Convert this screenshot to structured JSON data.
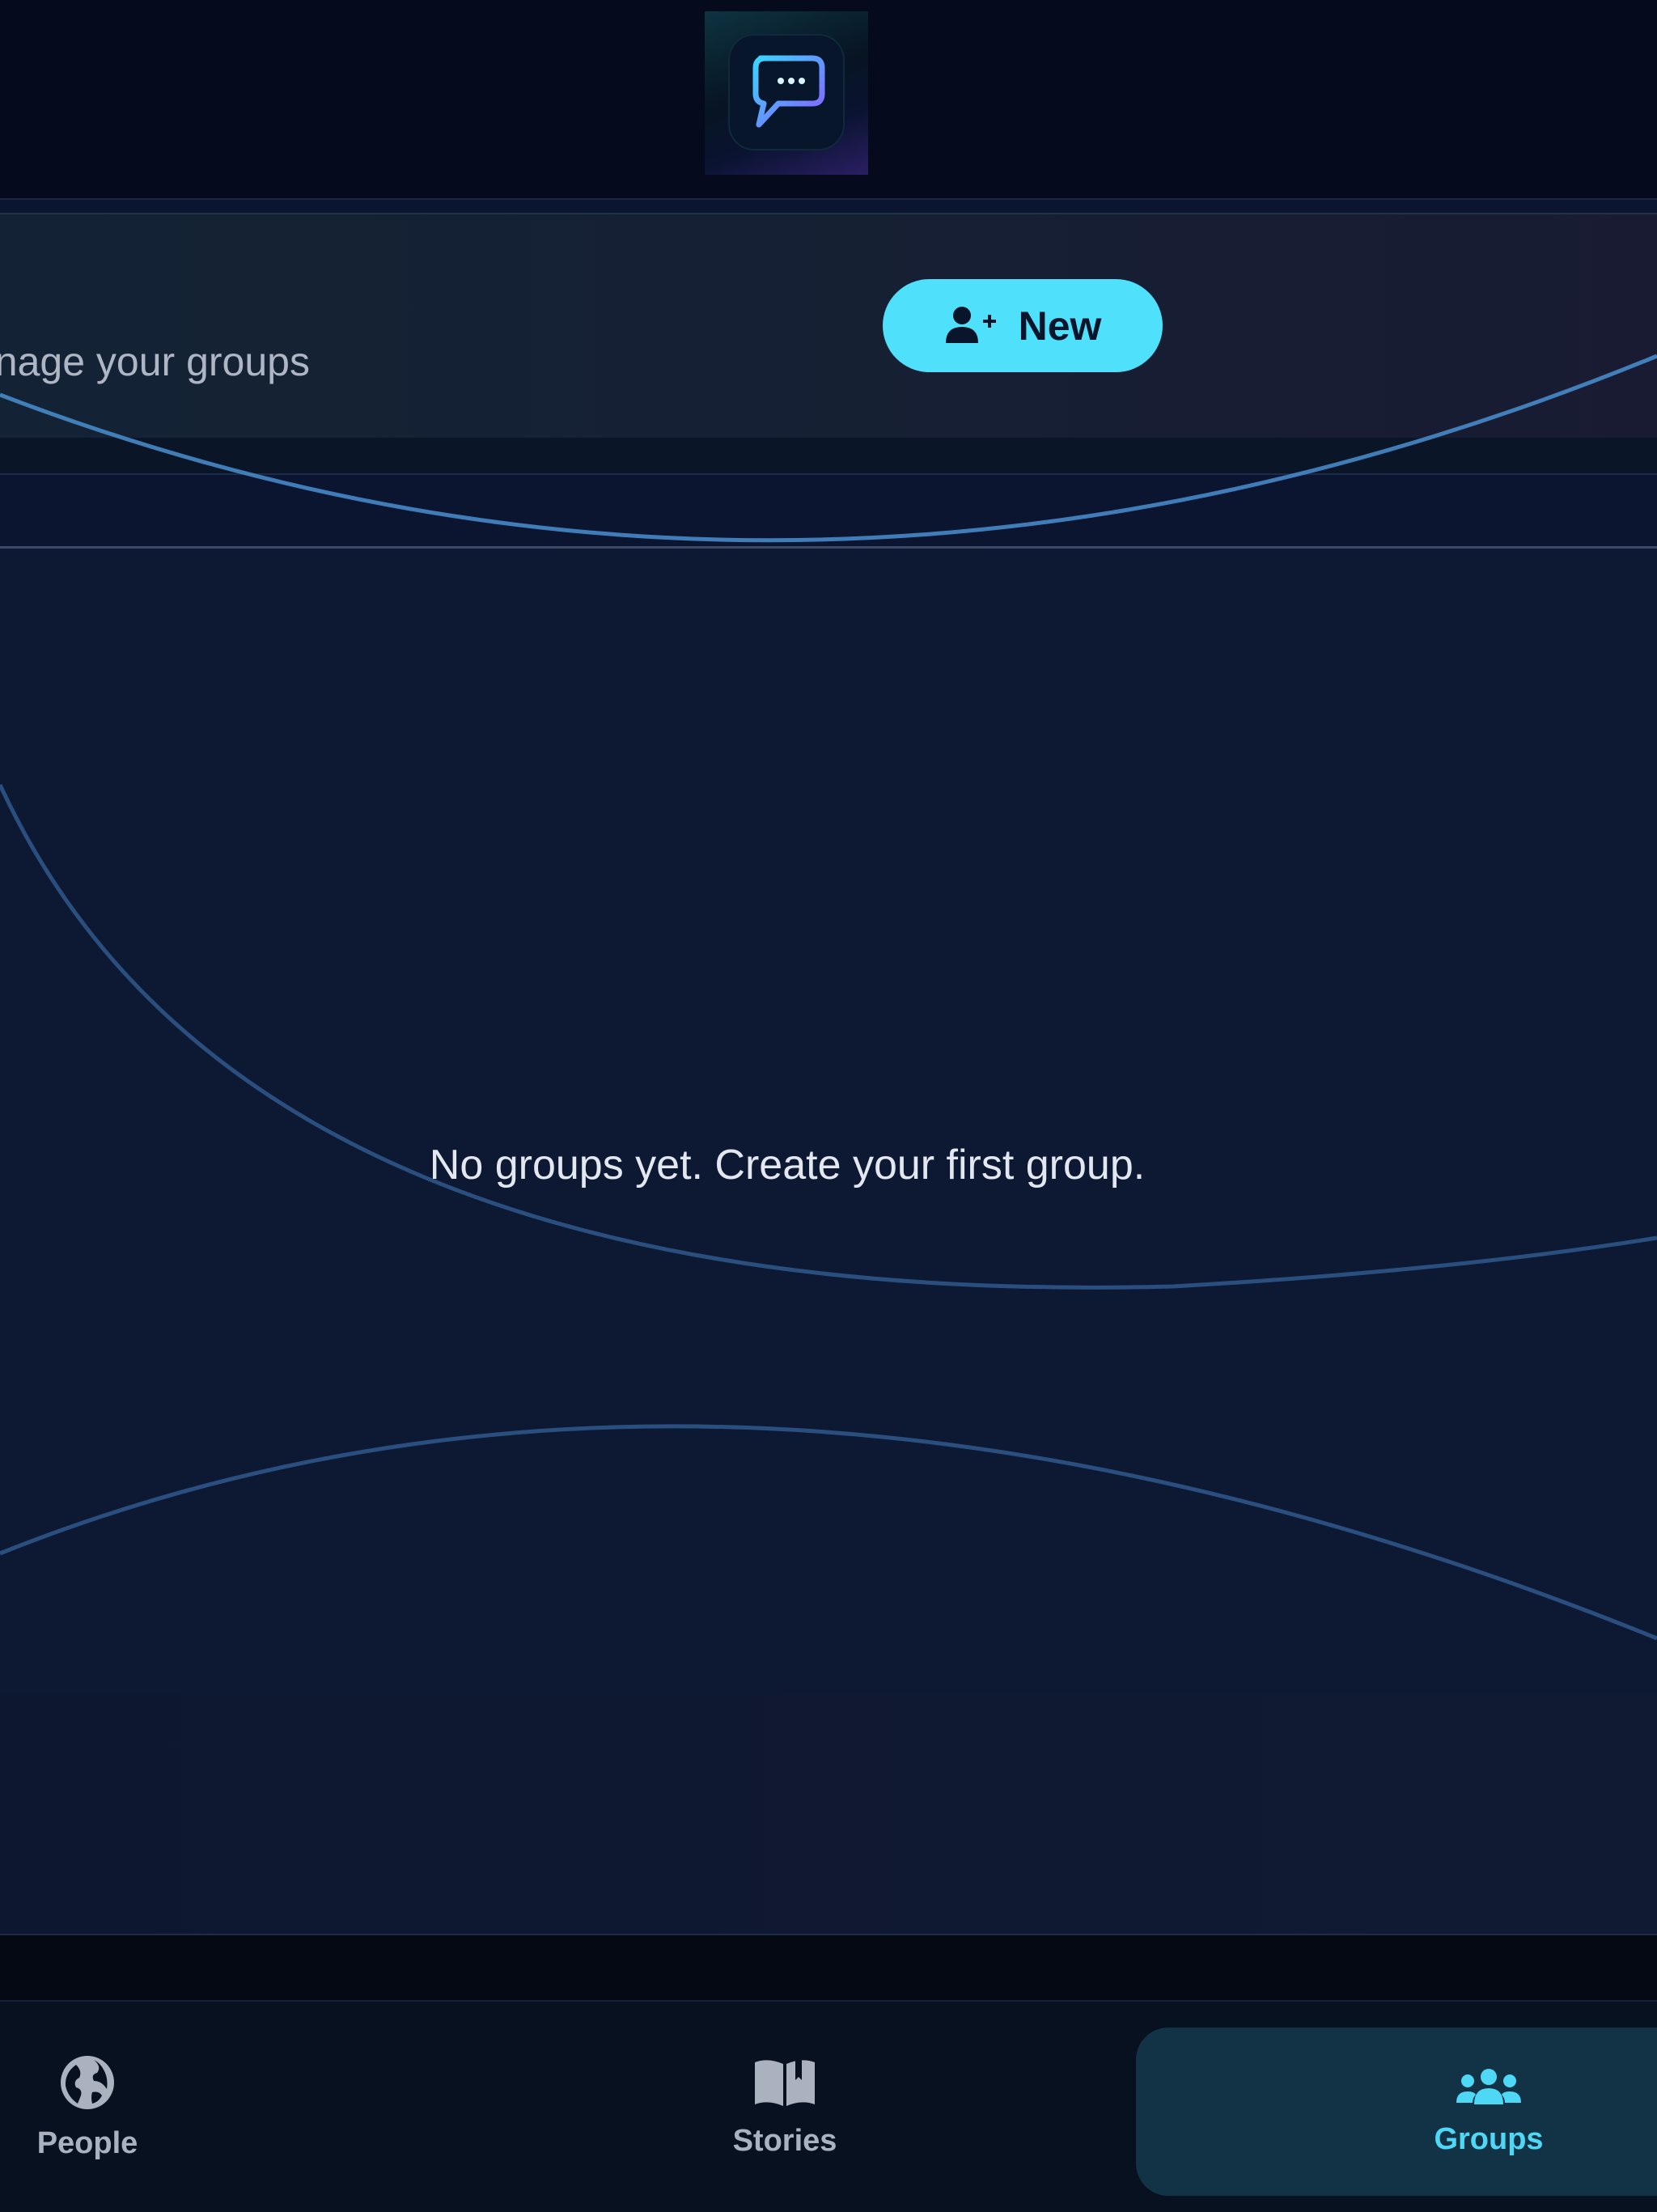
{
  "header": {
    "subtitle": "anage your groups",
    "new_button_label": "New"
  },
  "main": {
    "empty_message": "No groups yet. Create your first group."
  },
  "bottom_nav": {
    "items": [
      {
        "label": "People",
        "icon": "globe-icon",
        "active": false
      },
      {
        "label": "Stories",
        "icon": "open-book-icon",
        "active": false
      },
      {
        "label": "Groups",
        "icon": "users-icon",
        "active": true
      }
    ]
  },
  "colors": {
    "accent": "#4fe0fb",
    "background": "#0b1530",
    "active_nav_bg": "#123246"
  },
  "icons": {
    "app_logo": "chat-bubble-icon",
    "new_button_icon": "add-user-icon"
  }
}
